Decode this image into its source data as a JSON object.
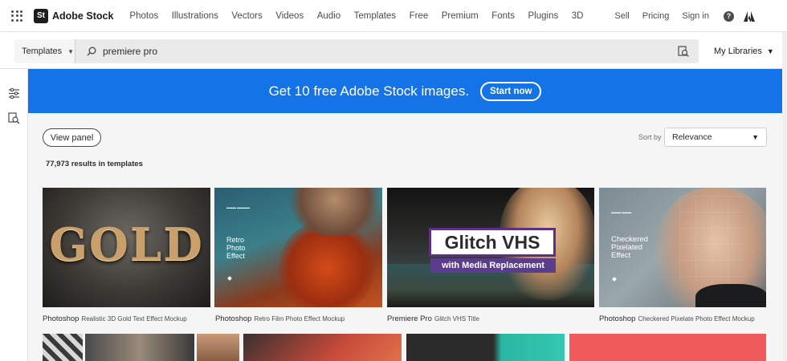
{
  "topnav": {
    "brand": "Adobe Stock",
    "brand_badge": "St",
    "links": [
      "Photos",
      "Illustrations",
      "Vectors",
      "Videos",
      "Audio",
      "Templates",
      "Free",
      "Premium",
      "Fonts",
      "Plugins",
      "3D"
    ],
    "right_links": [
      "Sell",
      "Pricing",
      "Sign in"
    ],
    "help_glyph": "?"
  },
  "search": {
    "type_label": "Templates",
    "query": "premiere pro",
    "libraries_label": "My Libraries"
  },
  "banner": {
    "text": "Get 10 free Adobe Stock images.",
    "button": "Start now",
    "color": "#1473e6"
  },
  "toolbar": {
    "view_panel": "View panel",
    "sort_label": "Sort by",
    "sort_value": "Relevance",
    "results": "77,973 results in templates"
  },
  "cards": [
    {
      "app": "Photoshop",
      "title": "Realistic 3D Gold Text Effect Mockup",
      "art_text": "GOLD"
    },
    {
      "app": "Photoshop",
      "title": "Retro Film Photo Effect Mockup",
      "art_text_lines": [
        "Retro",
        "Photo",
        "Effect"
      ]
    },
    {
      "app": "Premiere Pro",
      "title": "Glitch VHS Title",
      "art_title": "Glitch VHS",
      "art_sub": "with Media Replacement"
    },
    {
      "app": "Photoshop",
      "title": "Checkered Pixelate Photo Effect Mockup",
      "art_text_lines": [
        "Checkered",
        "Pixelated",
        "Effect"
      ]
    }
  ]
}
